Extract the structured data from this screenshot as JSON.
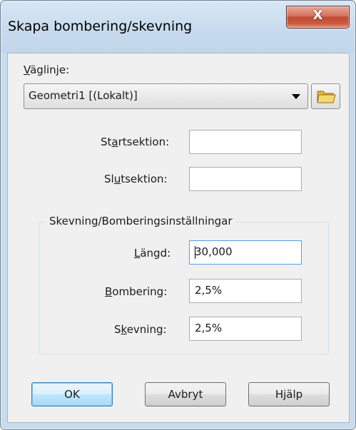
{
  "window": {
    "title": "Skapa bombering/skevning",
    "close_glyph": "X"
  },
  "road_line": {
    "label_prefix": "",
    "label_mnemonic": "V",
    "label_rest": "äglinje:",
    "selected": "Geometri1 [(Lokalt)]",
    "browse_icon": "folder-icon"
  },
  "start_section": {
    "label_a": "St",
    "label_mnemonic": "a",
    "label_b": "rtsektion:",
    "value": ""
  },
  "end_section": {
    "label_a": "Sl",
    "label_mnemonic": "u",
    "label_b": "tsektion:",
    "value": ""
  },
  "settings": {
    "title": "Skevning/Bomberingsinställningar",
    "length": {
      "label_mnemonic": "L",
      "label_rest": "ängd:",
      "value": "30,000"
    },
    "crown": {
      "label_mnemonic": "B",
      "label_rest": "ombering:",
      "value": "2,5%"
    },
    "superelevation": {
      "label_a": "S",
      "label_mnemonic": "k",
      "label_b": "evning:",
      "value": "2,5%"
    }
  },
  "buttons": {
    "ok": "OK",
    "cancel": "Avbryt",
    "help": "Hjälp"
  },
  "colors": {
    "close_button": "#c24a33",
    "default_button": "#bee6fd",
    "focus_border": "#569de5"
  }
}
